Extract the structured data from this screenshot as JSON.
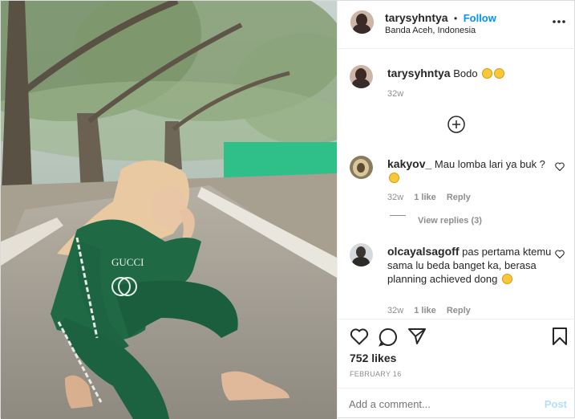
{
  "photo": {
    "alt": "Woman in green tracksuit posing on a tree-lined path"
  },
  "header": {
    "username": "tarysyhntya",
    "separator": "•",
    "follow_label": "Follow",
    "location": "Banda Aceh, Indonesia"
  },
  "caption": {
    "username": "tarysyhntya",
    "text": "Bodo",
    "time": "32w"
  },
  "comments": [
    {
      "username": "kakyov_",
      "text": "Mau lomba lari ya buk ?",
      "time": "32w",
      "likes": "1 like",
      "reply_label": "Reply",
      "view_replies": "View replies (3)"
    },
    {
      "username": "olcayalsagoff",
      "text": "pas pertama ktemu sama lu beda banget ka, berasa planning achieved dong",
      "time": "32w",
      "likes": "1 like",
      "reply_label": "Reply"
    }
  ],
  "stats": {
    "likes": "752 likes",
    "date": "FEBRUARY 16"
  },
  "composer": {
    "placeholder": "Add a comment...",
    "post_label": "Post"
  },
  "colors": {
    "follow_blue": "#0095f6",
    "post_disabled": "#b2dffc",
    "grey_text": "#8e8e8e",
    "tracksuit_green": "#1f6a45"
  }
}
